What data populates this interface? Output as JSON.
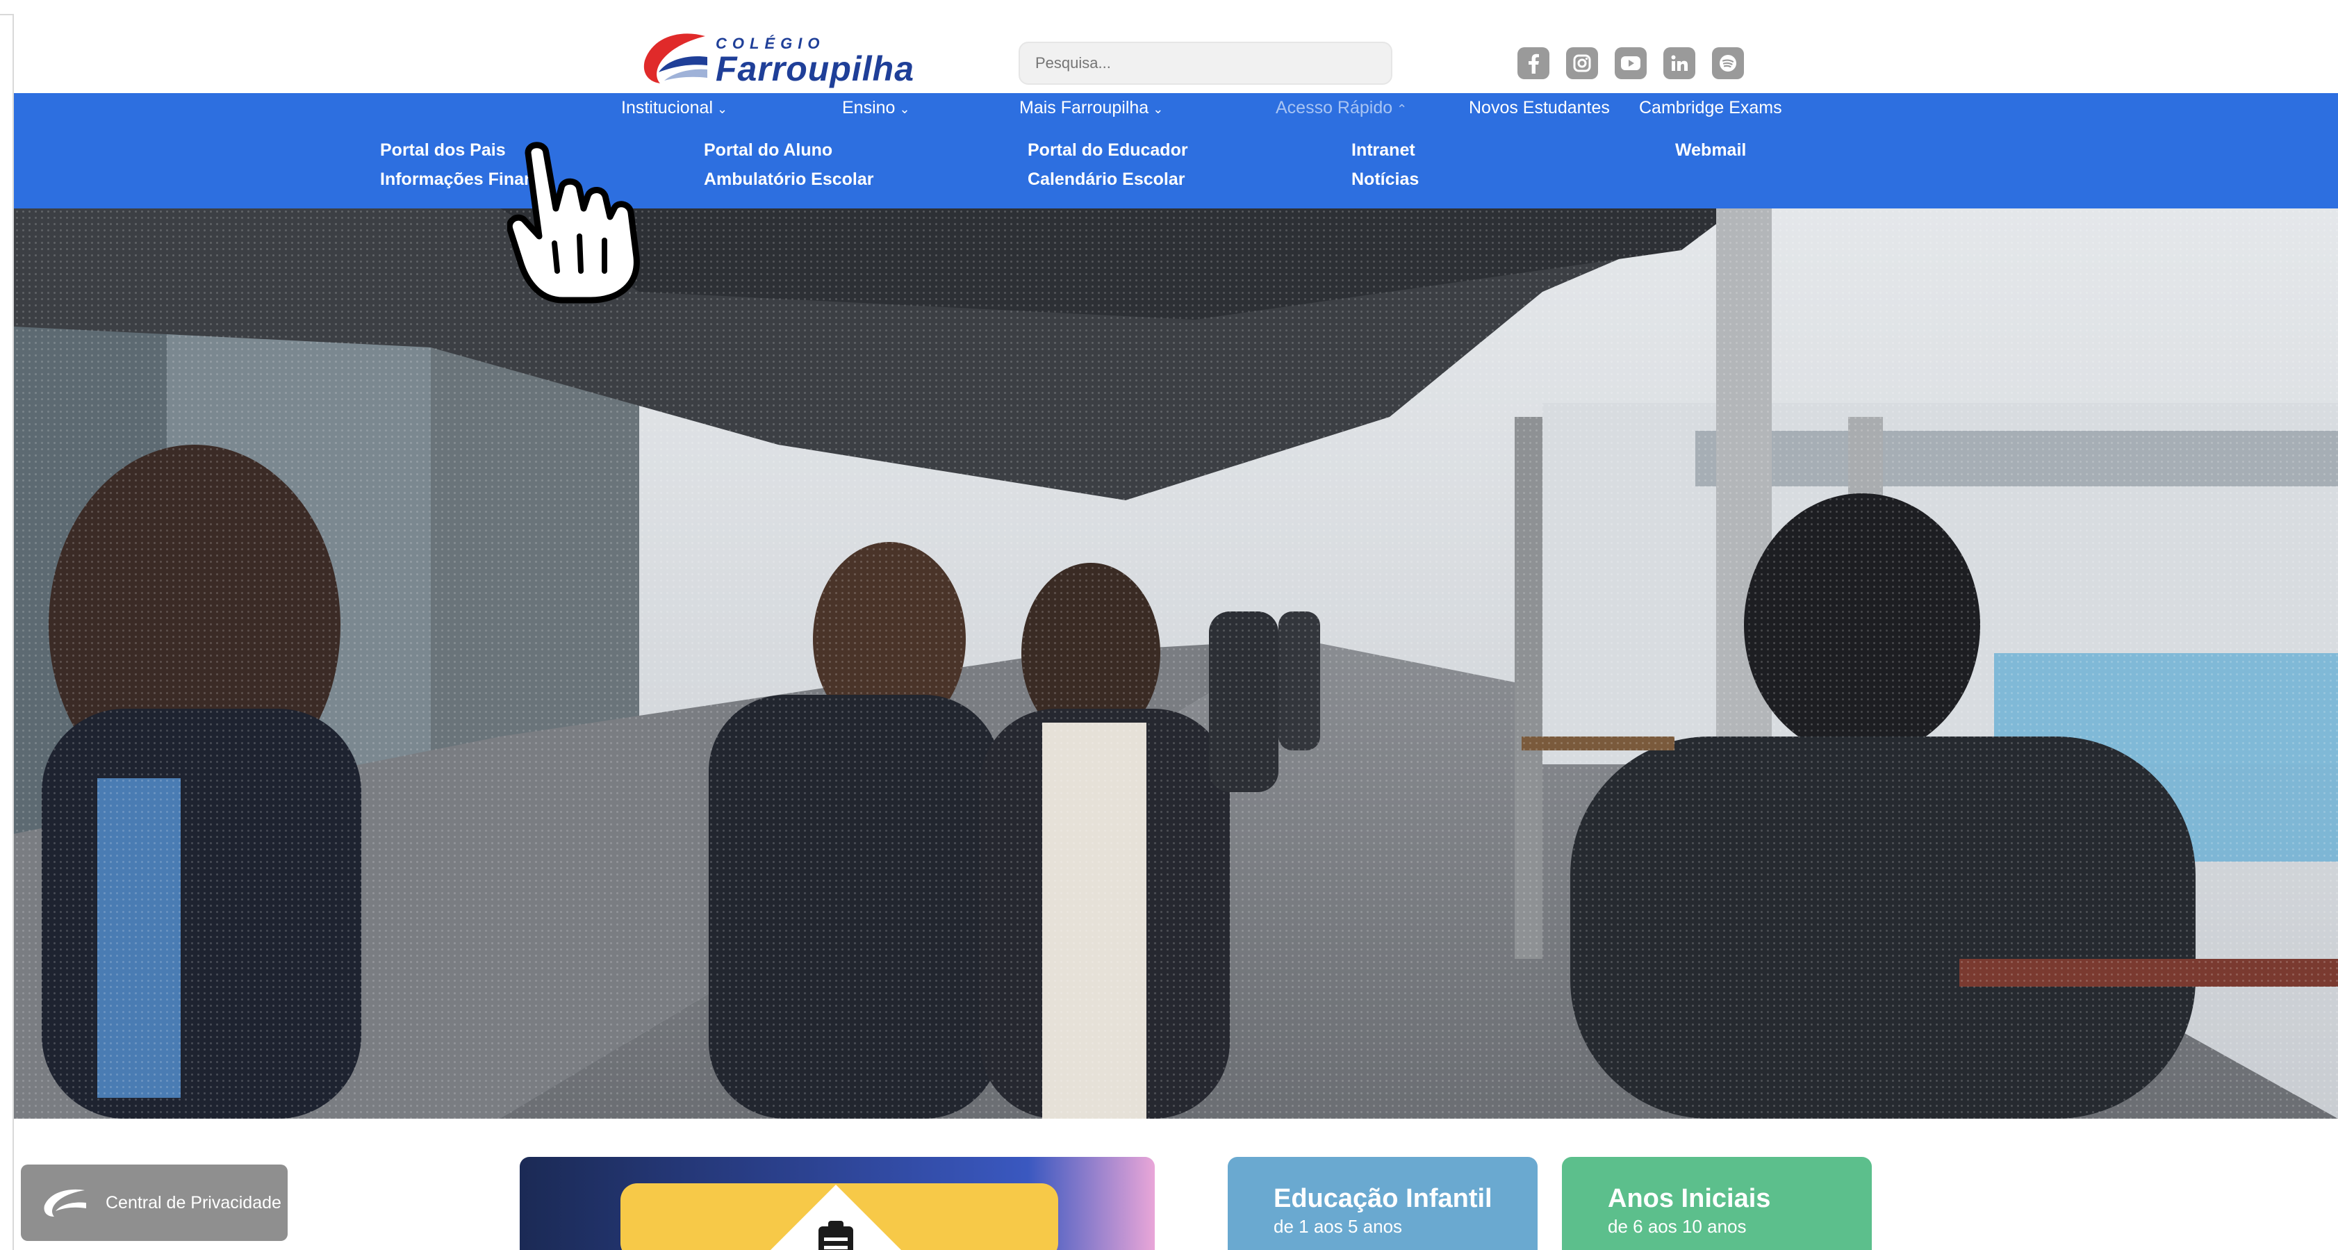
{
  "header": {
    "logo": {
      "small_text": "COLÉGIO",
      "big_text": "Farroupilha"
    },
    "search": {
      "placeholder": "Pesquisa..."
    },
    "social": [
      "facebook-icon",
      "instagram-icon",
      "youtube-icon",
      "linkedin-icon",
      "spotify-icon"
    ]
  },
  "nav": {
    "items": [
      {
        "label": "Institucional",
        "has_dropdown": true,
        "expanded": false
      },
      {
        "label": "Ensino",
        "has_dropdown": true,
        "expanded": false
      },
      {
        "label": "Mais Farroupilha",
        "has_dropdown": true,
        "expanded": false
      },
      {
        "label": "Acesso Rápido",
        "has_dropdown": true,
        "expanded": true
      },
      {
        "label": "Novos Estudantes",
        "has_dropdown": false
      },
      {
        "label": "Cambridge Exams",
        "has_dropdown": false
      }
    ],
    "chevron_down": "⌄",
    "chevron_up": "⌃"
  },
  "dropdown": {
    "links": [
      "Portal dos Pais",
      "Informações Financ",
      "Portal do Aluno",
      "Ambulatório Escolar",
      "Portal do Educador",
      "Calendário Escolar",
      "Intranet",
      "Notícias",
      "Webmail"
    ]
  },
  "privacy": {
    "label": "Central de Privacidade"
  },
  "cards": [
    {
      "title": "Educação Infantil",
      "subtitle": "de 1 aos 5 anos",
      "color": "#6aa9d0"
    },
    {
      "title": "Anos Iniciais",
      "subtitle": "de 6 aos 10 anos",
      "color": "#5cbf8c"
    }
  ],
  "colors": {
    "nav_bg": "#2d6fe0",
    "brand_blue": "#1f3f98",
    "brand_red": "#e02a2a"
  }
}
